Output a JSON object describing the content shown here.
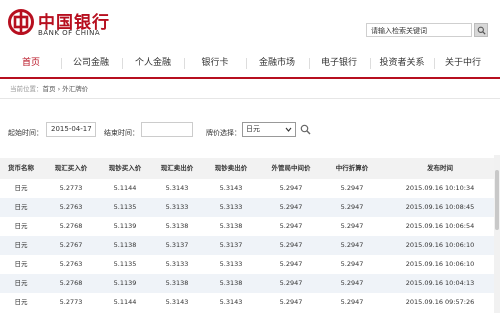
{
  "header": {
    "logo_cn": "中国银行",
    "logo_en": "BANK OF CHINA",
    "search_placeholder": "请输入检索关键词",
    "brand_color": "#b70f1f"
  },
  "nav": {
    "items": [
      {
        "label": "首页",
        "active": true
      },
      {
        "label": "公司金融",
        "active": false
      },
      {
        "label": "个人金融",
        "active": false
      },
      {
        "label": "银行卡",
        "active": false
      },
      {
        "label": "金融市场",
        "active": false
      },
      {
        "label": "电子银行",
        "active": false
      },
      {
        "label": "投资者关系",
        "active": false
      },
      {
        "label": "关于中行",
        "active": false
      }
    ]
  },
  "breadcrumb": {
    "label": "当前位置：",
    "path": "首页 › 外汇牌价"
  },
  "filter": {
    "start_label": "起始时间：",
    "start_value": "2015-04-17",
    "end_label": "结束时间：",
    "end_value": "",
    "currency_label": "牌价选择：",
    "currency_value": "日元"
  },
  "table": {
    "headers": [
      "货币名称",
      "现汇买入价",
      "现钞买入价",
      "现汇卖出价",
      "现钞卖出价",
      "外管局中间价",
      "中行折算价",
      "发布时间"
    ],
    "rows": [
      [
        "日元",
        "5.2773",
        "5.1144",
        "5.3143",
        "5.3143",
        "5.2947",
        "5.2947",
        "2015.09.16 10:10:34"
      ],
      [
        "日元",
        "5.2763",
        "5.1135",
        "5.3133",
        "5.3133",
        "5.2947",
        "5.2947",
        "2015.09.16 10:08:45"
      ],
      [
        "日元",
        "5.2768",
        "5.1139",
        "5.3138",
        "5.3138",
        "5.2947",
        "5.2947",
        "2015.09.16 10:06:54"
      ],
      [
        "日元",
        "5.2767",
        "5.1138",
        "5.3137",
        "5.3137",
        "5.2947",
        "5.2947",
        "2015.09.16 10:06:10"
      ],
      [
        "日元",
        "5.2763",
        "5.1135",
        "5.3133",
        "5.3133",
        "5.2947",
        "5.2947",
        "2015.09.16 10:06:10"
      ],
      [
        "日元",
        "5.2768",
        "5.1139",
        "5.3138",
        "5.3138",
        "5.2947",
        "5.2947",
        "2015.09.16 10:04:13"
      ],
      [
        "日元",
        "5.2773",
        "5.1144",
        "5.3143",
        "5.3143",
        "5.2947",
        "5.2947",
        "2015.09.16 09:57:26"
      ]
    ]
  }
}
